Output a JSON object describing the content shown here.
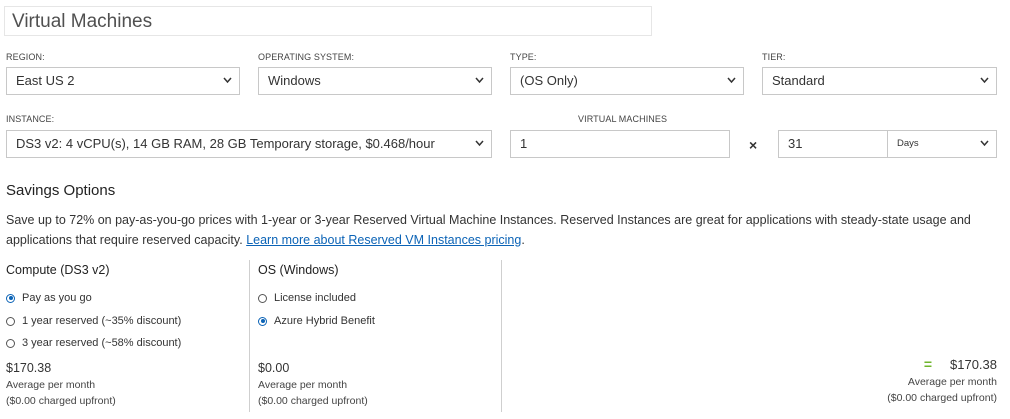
{
  "header": {
    "title": "Virtual Machines"
  },
  "config": {
    "region": {
      "label": "REGION:",
      "value": "East US 2"
    },
    "os": {
      "label": "OPERATING SYSTEM:",
      "value": "Windows"
    },
    "type": {
      "label": "TYPE:",
      "value": "(OS Only)"
    },
    "tier": {
      "label": "TIER:",
      "value": "Standard"
    },
    "instance": {
      "label": "INSTANCE:",
      "value": "DS3 v2: 4 vCPU(s), 14 GB RAM, 28 GB Temporary storage, $0.468/hour"
    },
    "vms": {
      "label": "VIRTUAL MACHINES",
      "value": "1"
    },
    "multiply": "×",
    "duration": {
      "value": "31",
      "unit": "Days"
    }
  },
  "savings": {
    "heading": "Savings Options",
    "description": "Save up to 72% on pay-as-you-go prices with 1-year or 3-year Reserved Virtual Machine Instances. Reserved Instances are great for applications with steady-state usage and applications that require reserved capacity.",
    "link_text": "Learn more about Reserved VM Instances pricing",
    "link_suffix": ".",
    "compute": {
      "title": "Compute (DS3 v2)",
      "options": [
        "Pay as you go",
        "1 year reserved (~35% discount)",
        "3 year reserved (~58% discount)"
      ],
      "selected_index": 0,
      "price": "$170.38",
      "avg_label": "Average per month",
      "upfront": "($0.00 charged upfront)"
    },
    "os": {
      "title": "OS (Windows)",
      "options": [
        "License included",
        "Azure Hybrid Benefit"
      ],
      "selected_index": 1,
      "price": "$0.00",
      "avg_label": "Average per month",
      "upfront": "($0.00 charged upfront)"
    },
    "total": {
      "equals": "=",
      "price": "$170.38",
      "avg_label": "Average per month",
      "upfront": "($0.00 charged upfront)"
    }
  },
  "colors": {
    "accent": "#0b63b6",
    "equals": "#6fb52c",
    "border": "#c8c8c8"
  }
}
